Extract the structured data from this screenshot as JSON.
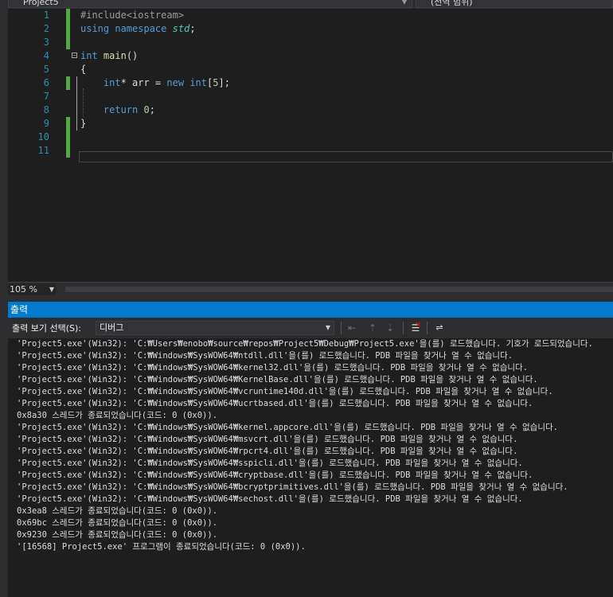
{
  "header": {
    "project_dropdown": "Project5",
    "scope_dropdown": "(전역 범위)"
  },
  "editor": {
    "lines": [
      {
        "n": "1",
        "tokens": [
          {
            "t": "#include<iostream>",
            "c": "pp"
          }
        ]
      },
      {
        "n": "2",
        "tokens": [
          {
            "t": "using",
            "c": "kw"
          },
          {
            "t": " ",
            "c": ""
          },
          {
            "t": "namespace",
            "c": "kw"
          },
          {
            "t": " ",
            "c": ""
          },
          {
            "t": "std",
            "c": "it"
          },
          {
            "t": ";",
            "c": ""
          }
        ]
      },
      {
        "n": "3",
        "tokens": []
      },
      {
        "n": "4",
        "tokens": [
          {
            "t": "int",
            "c": "kw"
          },
          {
            "t": " ",
            "c": ""
          },
          {
            "t": "main",
            "c": "fn"
          },
          {
            "t": "()",
            "c": ""
          }
        ]
      },
      {
        "n": "5",
        "tokens": [
          {
            "t": "{",
            "c": ""
          }
        ]
      },
      {
        "n": "6",
        "tokens": [
          {
            "t": "    ",
            "c": ""
          },
          {
            "t": "int",
            "c": "kw"
          },
          {
            "t": "* arr = ",
            "c": ""
          },
          {
            "t": "new",
            "c": "kw"
          },
          {
            "t": " ",
            "c": ""
          },
          {
            "t": "int",
            "c": "kw"
          },
          {
            "t": "[",
            "c": ""
          },
          {
            "t": "5",
            "c": "num"
          },
          {
            "t": "];",
            "c": ""
          }
        ]
      },
      {
        "n": "7",
        "tokens": []
      },
      {
        "n": "8",
        "tokens": [
          {
            "t": "    ",
            "c": ""
          },
          {
            "t": "return",
            "c": "kw"
          },
          {
            "t": " ",
            "c": ""
          },
          {
            "t": "0",
            "c": "num"
          },
          {
            "t": ";",
            "c": ""
          }
        ]
      },
      {
        "n": "9",
        "tokens": [
          {
            "t": "}",
            "c": ""
          }
        ]
      },
      {
        "n": "10",
        "tokens": []
      },
      {
        "n": "11",
        "tokens": []
      }
    ]
  },
  "zoom": {
    "value": "105 %"
  },
  "output_panel": {
    "title": "출력",
    "show_label": "출력 보기 선택(S):",
    "source": "디버그",
    "lines": [
      "'Project5.exe'(Win32): 'C:₩Users₩enobo₩source₩repos₩Project5₩Debug₩Project5.exe'을(를) 로드했습니다. 기호가 로드되었습니다.",
      "'Project5.exe'(Win32): 'C:₩Windows₩SysWOW64₩ntdll.dll'을(를) 로드했습니다. PDB 파일을 찾거나 열 수 없습니다.",
      "'Project5.exe'(Win32): 'C:₩Windows₩SysWOW64₩kernel32.dll'을(를) 로드했습니다. PDB 파일을 찾거나 열 수 없습니다.",
      "'Project5.exe'(Win32): 'C:₩Windows₩SysWOW64₩KernelBase.dll'을(를) 로드했습니다. PDB 파일을 찾거나 열 수 없습니다.",
      "'Project5.exe'(Win32): 'C:₩Windows₩SysWOW64₩vcruntime140d.dll'을(를) 로드했습니다. PDB 파일을 찾거나 열 수 없습니다.",
      "'Project5.exe'(Win32): 'C:₩Windows₩SysWOW64₩ucrtbased.dll'을(를) 로드했습니다. PDB 파일을 찾거나 열 수 없습니다.",
      "0x8a30 스레드가 종료되었습니다(코드: 0 (0x0)).",
      "'Project5.exe'(Win32): 'C:₩Windows₩SysWOW64₩kernel.appcore.dll'을(를) 로드했습니다. PDB 파일을 찾거나 열 수 없습니다.",
      "'Project5.exe'(Win32): 'C:₩Windows₩SysWOW64₩msvcrt.dll'을(를) 로드했습니다. PDB 파일을 찾거나 열 수 없습니다.",
      "'Project5.exe'(Win32): 'C:₩Windows₩SysWOW64₩rpcrt4.dll'을(를) 로드했습니다. PDB 파일을 찾거나 열 수 없습니다.",
      "'Project5.exe'(Win32): 'C:₩Windows₩SysWOW64₩sspicli.dll'을(를) 로드했습니다. PDB 파일을 찾거나 열 수 없습니다.",
      "'Project5.exe'(Win32): 'C:₩Windows₩SysWOW64₩cryptbase.dll'을(를) 로드했습니다. PDB 파일을 찾거나 열 수 없습니다.",
      "'Project5.exe'(Win32): 'C:₩Windows₩SysWOW64₩bcryptprimitives.dll'을(를) 로드했습니다. PDB 파일을 찾거나 열 수 없습니다.",
      "'Project5.exe'(Win32): 'C:₩Windows₩SysWOW64₩sechost.dll'을(를) 로드했습니다. PDB 파일을 찾거나 열 수 없습니다.",
      "0x3ea8 스레드가 종료되었습니다(코드: 0 (0x0)).",
      "0x69bc 스레드가 종료되었습니다(코드: 0 (0x0)).",
      "0x9230 스레드가 종료되었습니다(코드: 0 (0x0)).",
      "'[16568] Project5.exe' 프로그램이 종료되었습니다(코드: 0 (0x0))."
    ]
  },
  "icons": {
    "prev_message": "find-prev-icon",
    "go_prev": "go-prev-icon",
    "go_next": "go-next-icon",
    "clear_all": "clear-all-icon",
    "word_wrap": "word-wrap-icon"
  },
  "colors": {
    "accent": "#007acc",
    "keyword": "#569cd6",
    "line_number": "#2b91af",
    "change_marker": "#57a64a"
  }
}
